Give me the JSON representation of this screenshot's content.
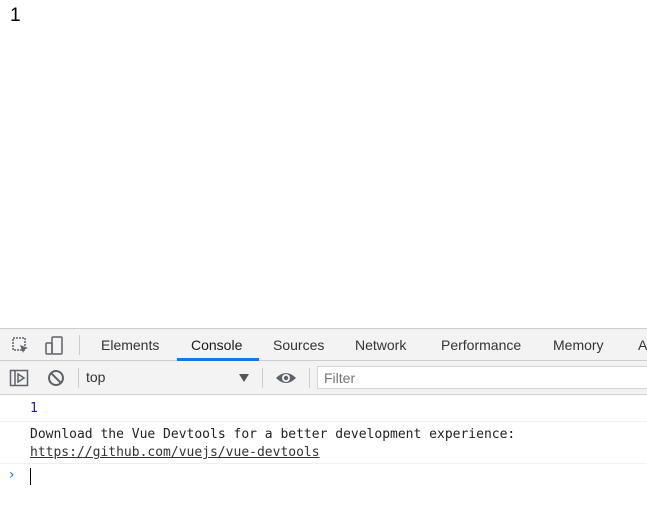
{
  "page": {
    "content_text": "1"
  },
  "devtools": {
    "tabs": [
      {
        "label": "Elements"
      },
      {
        "label": "Console"
      },
      {
        "label": "Sources"
      },
      {
        "label": "Network"
      },
      {
        "label": "Performance"
      },
      {
        "label": "Memory"
      },
      {
        "label": "A"
      }
    ],
    "active_tab": "Console",
    "accent_color": "#1a73e8",
    "icons": {
      "inspect": "inspect-element-icon",
      "device": "device-toolbar-icon",
      "sidebar": "show-sidebar-icon",
      "clear": "clear-console-icon",
      "eye": "live-expression-icon"
    },
    "toolbar": {
      "context": "top",
      "filter_placeholder": "Filter"
    },
    "console": {
      "messages": [
        {
          "text": "1"
        },
        {
          "text": "Download the Vue Devtools for a better development experience:",
          "link": "https://github.com/vuejs/vue-devtools"
        }
      ]
    }
  }
}
